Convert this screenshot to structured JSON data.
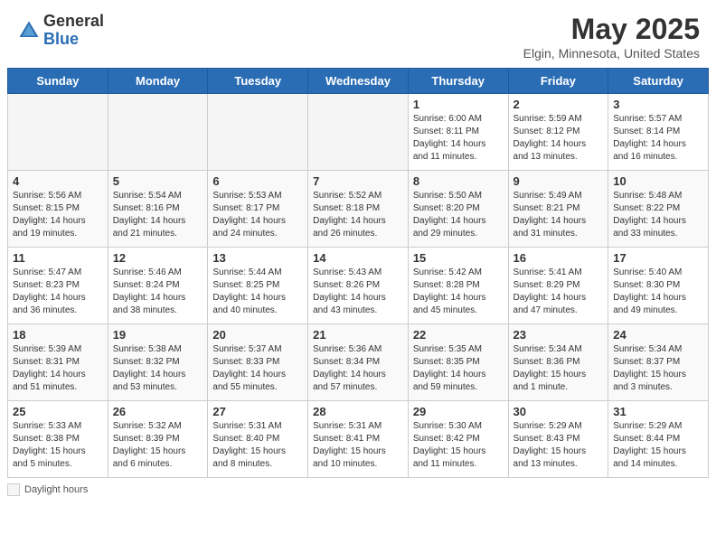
{
  "header": {
    "logo_general": "General",
    "logo_blue": "Blue",
    "month_title": "May 2025",
    "location": "Elgin, Minnesota, United States"
  },
  "weekdays": [
    "Sunday",
    "Monday",
    "Tuesday",
    "Wednesday",
    "Thursday",
    "Friday",
    "Saturday"
  ],
  "legend": {
    "label": "Daylight hours"
  },
  "weeks": [
    [
      {
        "day": "",
        "empty": true
      },
      {
        "day": "",
        "empty": true
      },
      {
        "day": "",
        "empty": true
      },
      {
        "day": "",
        "empty": true
      },
      {
        "day": "1",
        "sunrise": "6:00 AM",
        "sunset": "8:11 PM",
        "daylight": "14 hours and 11 minutes."
      },
      {
        "day": "2",
        "sunrise": "5:59 AM",
        "sunset": "8:12 PM",
        "daylight": "14 hours and 13 minutes."
      },
      {
        "day": "3",
        "sunrise": "5:57 AM",
        "sunset": "8:14 PM",
        "daylight": "14 hours and 16 minutes."
      }
    ],
    [
      {
        "day": "4",
        "sunrise": "5:56 AM",
        "sunset": "8:15 PM",
        "daylight": "14 hours and 19 minutes."
      },
      {
        "day": "5",
        "sunrise": "5:54 AM",
        "sunset": "8:16 PM",
        "daylight": "14 hours and 21 minutes."
      },
      {
        "day": "6",
        "sunrise": "5:53 AM",
        "sunset": "8:17 PM",
        "daylight": "14 hours and 24 minutes."
      },
      {
        "day": "7",
        "sunrise": "5:52 AM",
        "sunset": "8:18 PM",
        "daylight": "14 hours and 26 minutes."
      },
      {
        "day": "8",
        "sunrise": "5:50 AM",
        "sunset": "8:20 PM",
        "daylight": "14 hours and 29 minutes."
      },
      {
        "day": "9",
        "sunrise": "5:49 AM",
        "sunset": "8:21 PM",
        "daylight": "14 hours and 31 minutes."
      },
      {
        "day": "10",
        "sunrise": "5:48 AM",
        "sunset": "8:22 PM",
        "daylight": "14 hours and 33 minutes."
      }
    ],
    [
      {
        "day": "11",
        "sunrise": "5:47 AM",
        "sunset": "8:23 PM",
        "daylight": "14 hours and 36 minutes."
      },
      {
        "day": "12",
        "sunrise": "5:46 AM",
        "sunset": "8:24 PM",
        "daylight": "14 hours and 38 minutes."
      },
      {
        "day": "13",
        "sunrise": "5:44 AM",
        "sunset": "8:25 PM",
        "daylight": "14 hours and 40 minutes."
      },
      {
        "day": "14",
        "sunrise": "5:43 AM",
        "sunset": "8:26 PM",
        "daylight": "14 hours and 43 minutes."
      },
      {
        "day": "15",
        "sunrise": "5:42 AM",
        "sunset": "8:28 PM",
        "daylight": "14 hours and 45 minutes."
      },
      {
        "day": "16",
        "sunrise": "5:41 AM",
        "sunset": "8:29 PM",
        "daylight": "14 hours and 47 minutes."
      },
      {
        "day": "17",
        "sunrise": "5:40 AM",
        "sunset": "8:30 PM",
        "daylight": "14 hours and 49 minutes."
      }
    ],
    [
      {
        "day": "18",
        "sunrise": "5:39 AM",
        "sunset": "8:31 PM",
        "daylight": "14 hours and 51 minutes."
      },
      {
        "day": "19",
        "sunrise": "5:38 AM",
        "sunset": "8:32 PM",
        "daylight": "14 hours and 53 minutes."
      },
      {
        "day": "20",
        "sunrise": "5:37 AM",
        "sunset": "8:33 PM",
        "daylight": "14 hours and 55 minutes."
      },
      {
        "day": "21",
        "sunrise": "5:36 AM",
        "sunset": "8:34 PM",
        "daylight": "14 hours and 57 minutes."
      },
      {
        "day": "22",
        "sunrise": "5:35 AM",
        "sunset": "8:35 PM",
        "daylight": "14 hours and 59 minutes."
      },
      {
        "day": "23",
        "sunrise": "5:34 AM",
        "sunset": "8:36 PM",
        "daylight": "15 hours and 1 minute."
      },
      {
        "day": "24",
        "sunrise": "5:34 AM",
        "sunset": "8:37 PM",
        "daylight": "15 hours and 3 minutes."
      }
    ],
    [
      {
        "day": "25",
        "sunrise": "5:33 AM",
        "sunset": "8:38 PM",
        "daylight": "15 hours and 5 minutes."
      },
      {
        "day": "26",
        "sunrise": "5:32 AM",
        "sunset": "8:39 PM",
        "daylight": "15 hours and 6 minutes."
      },
      {
        "day": "27",
        "sunrise": "5:31 AM",
        "sunset": "8:40 PM",
        "daylight": "15 hours and 8 minutes."
      },
      {
        "day": "28",
        "sunrise": "5:31 AM",
        "sunset": "8:41 PM",
        "daylight": "15 hours and 10 minutes."
      },
      {
        "day": "29",
        "sunrise": "5:30 AM",
        "sunset": "8:42 PM",
        "daylight": "15 hours and 11 minutes."
      },
      {
        "day": "30",
        "sunrise": "5:29 AM",
        "sunset": "8:43 PM",
        "daylight": "15 hours and 13 minutes."
      },
      {
        "day": "31",
        "sunrise": "5:29 AM",
        "sunset": "8:44 PM",
        "daylight": "15 hours and 14 minutes."
      }
    ]
  ]
}
